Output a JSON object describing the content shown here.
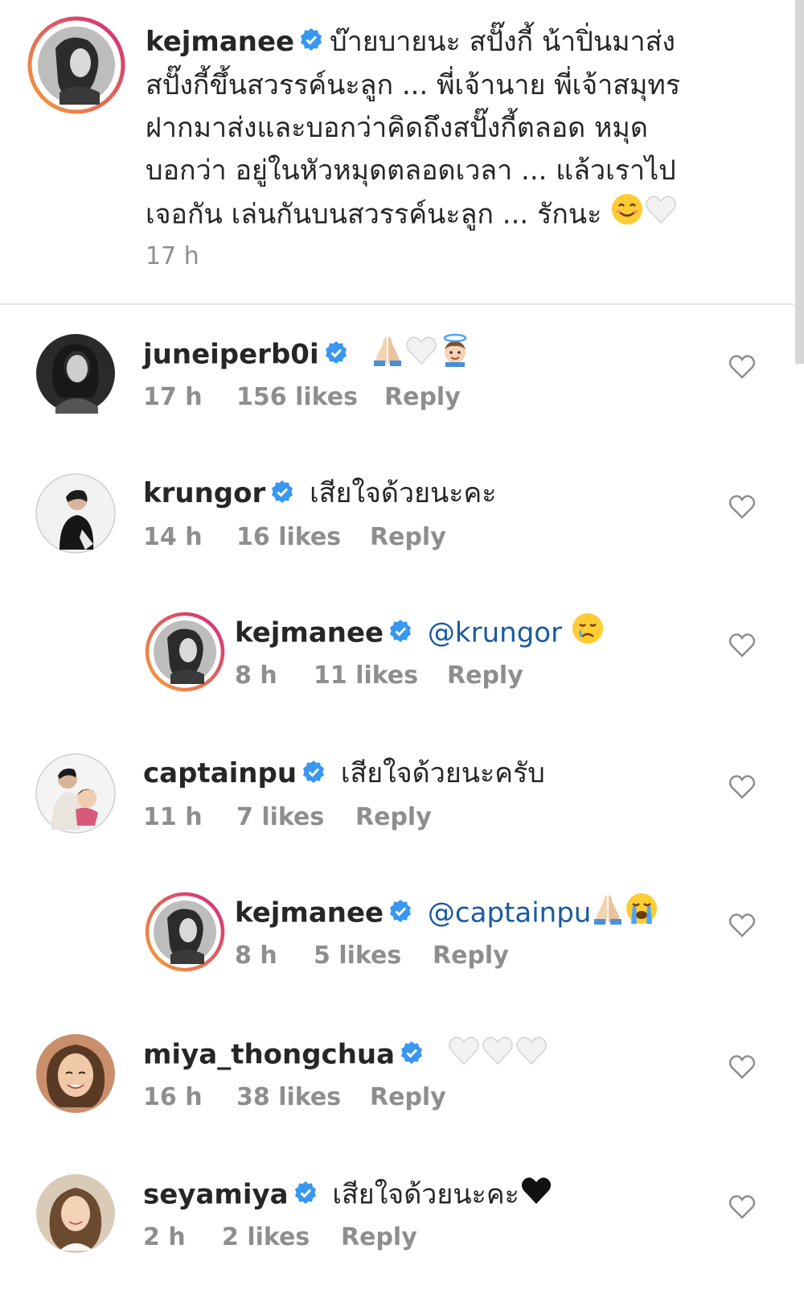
{
  "caption": {
    "username": "kejmanee",
    "lines": [
      "บ๊ายบายนะ สปั๊งกี้ น้าปิ่นมาส่ง",
      "สปั๊งกี้ขึ้นสวรรค์นะลูก ... พี่เจ้านาย พี่เจ้าสมุทร",
      "ฝากมาส่งและบอกว่าคิดถึงสปั๊งกี้ตลอด หมุด",
      "บอกว่า อยู่ในหัวหมุดตลอดเวลา ... แล้วเราไป",
      "เจอกัน เล่นกันบนสวรรค์นะลูก ... รักนะ"
    ],
    "emojis": [
      "smiling-face-emoji",
      "white-heart-emoji"
    ],
    "time": "17 h"
  },
  "comments": [
    {
      "username": "juneiperb0i",
      "text": "",
      "emojis": [
        "folded-hands-emoji",
        "white-heart-emoji",
        "angel-emoji"
      ],
      "time": "17 h",
      "likes": "156 likes",
      "reply": "Reply",
      "reply_level": 0
    },
    {
      "username": "krungor",
      "text": "เสียใจด้วยนะคะ",
      "emojis": [],
      "time": "14 h",
      "likes": "16 likes",
      "reply": "Reply",
      "reply_level": 0
    },
    {
      "username": "kejmanee",
      "text": "@krungor",
      "emojis": [
        "crying-face-emoji"
      ],
      "time": "8 h",
      "likes": "11 likes",
      "reply": "Reply",
      "reply_level": 1
    },
    {
      "username": "captainpu",
      "text": "เสียใจด้วยนะครับ",
      "emojis": [],
      "time": "11 h",
      "likes": "7 likes",
      "reply": "Reply",
      "reply_level": 0
    },
    {
      "username": "kejmanee",
      "text": "@captainpu",
      "emojis": [
        "folded-hands-emoji",
        "loudly-crying-face-emoji"
      ],
      "time": "8 h",
      "likes": "5 likes",
      "reply": "Reply",
      "reply_level": 1
    },
    {
      "username": "miya_thongchua",
      "text": "",
      "emojis": [
        "white-heart-emoji",
        "white-heart-emoji",
        "white-heart-emoji"
      ],
      "time": "16 h",
      "likes": "38 likes",
      "reply": "Reply",
      "reply_level": 0
    },
    {
      "username": "seyamiya",
      "text": "เสียใจด้วยนะคะ",
      "emojis": [
        "black-heart-emoji"
      ],
      "time": "2 h",
      "likes": "2 likes",
      "reply": "Reply",
      "reply_level": 0
    }
  ],
  "colors": {
    "text": "#262626",
    "meta": "#8e8e8e",
    "verified": "#3897f0",
    "mention": "#1a5aa3",
    "story_ring_start": "#f6a03b",
    "story_ring_end": "#d02a7a",
    "divider": "#e6e6e6"
  }
}
